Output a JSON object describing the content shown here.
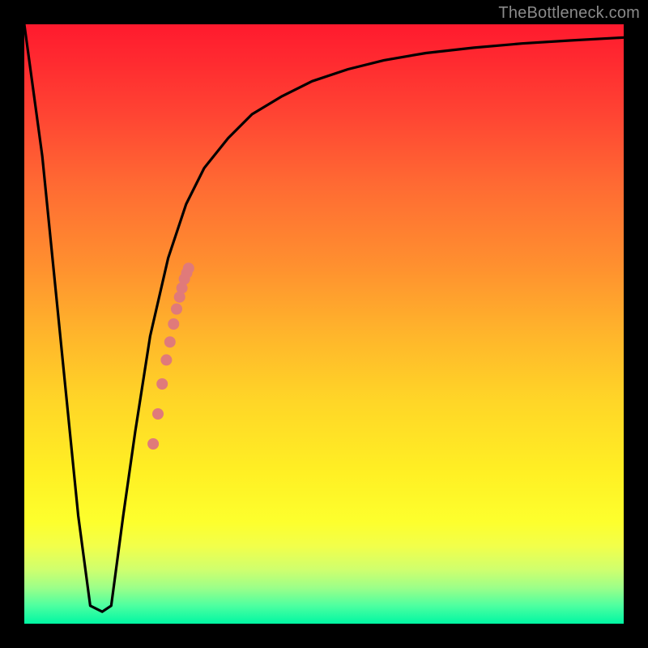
{
  "attribution": "TheBottleneck.com",
  "colors": {
    "frame": "#000000",
    "curve": "#000000",
    "marker": "#e07a7a",
    "gradient_stops": [
      "#ff1a2e",
      "#ff4433",
      "#ff8f2f",
      "#ffd627",
      "#fdff2d",
      "#9cff89",
      "#00f7a3"
    ]
  },
  "chart_data": {
    "type": "line",
    "title": "",
    "xlabel": "",
    "ylabel": "",
    "xlim": [
      0,
      100
    ],
    "ylim": [
      0,
      100
    ],
    "grid": false,
    "legend": false,
    "note": "x and y are in percent of the plot area; y=0 is the GREEN bottom (optimal), y=100 is the RED top (severe bottleneck). Curve estimated from pixels.",
    "series": [
      {
        "name": "bottleneck-curve",
        "x": [
          0,
          3,
          5,
          7,
          9,
          11,
          13,
          14.5,
          16.5,
          18.5,
          21,
          24,
          27,
          30,
          34,
          38,
          43,
          48,
          54,
          60,
          67,
          75,
          83,
          91,
          100
        ],
        "y": [
          100,
          78,
          58,
          38,
          18,
          3,
          2,
          3,
          18,
          32,
          48,
          61,
          70,
          76,
          81,
          85,
          88,
          90.5,
          92.5,
          94,
          95.2,
          96.1,
          96.8,
          97.3,
          97.8
        ]
      }
    ],
    "markers": {
      "name": "highlight-points",
      "description": "Salmon dots along the rising right wall of the V-curve, clustered ~21–28 on x, ~30–59 on y.",
      "points": [
        {
          "x": 21.5,
          "y": 30
        },
        {
          "x": 22.3,
          "y": 35
        },
        {
          "x": 23.0,
          "y": 40
        },
        {
          "x": 23.7,
          "y": 44
        },
        {
          "x": 24.3,
          "y": 47
        },
        {
          "x": 24.9,
          "y": 50
        },
        {
          "x": 25.4,
          "y": 52.5
        },
        {
          "x": 25.9,
          "y": 54.5
        },
        {
          "x": 26.3,
          "y": 56
        },
        {
          "x": 26.7,
          "y": 57.5
        },
        {
          "x": 27.1,
          "y": 58.5
        },
        {
          "x": 27.4,
          "y": 59.3
        }
      ],
      "marker_radius": 7
    }
  }
}
